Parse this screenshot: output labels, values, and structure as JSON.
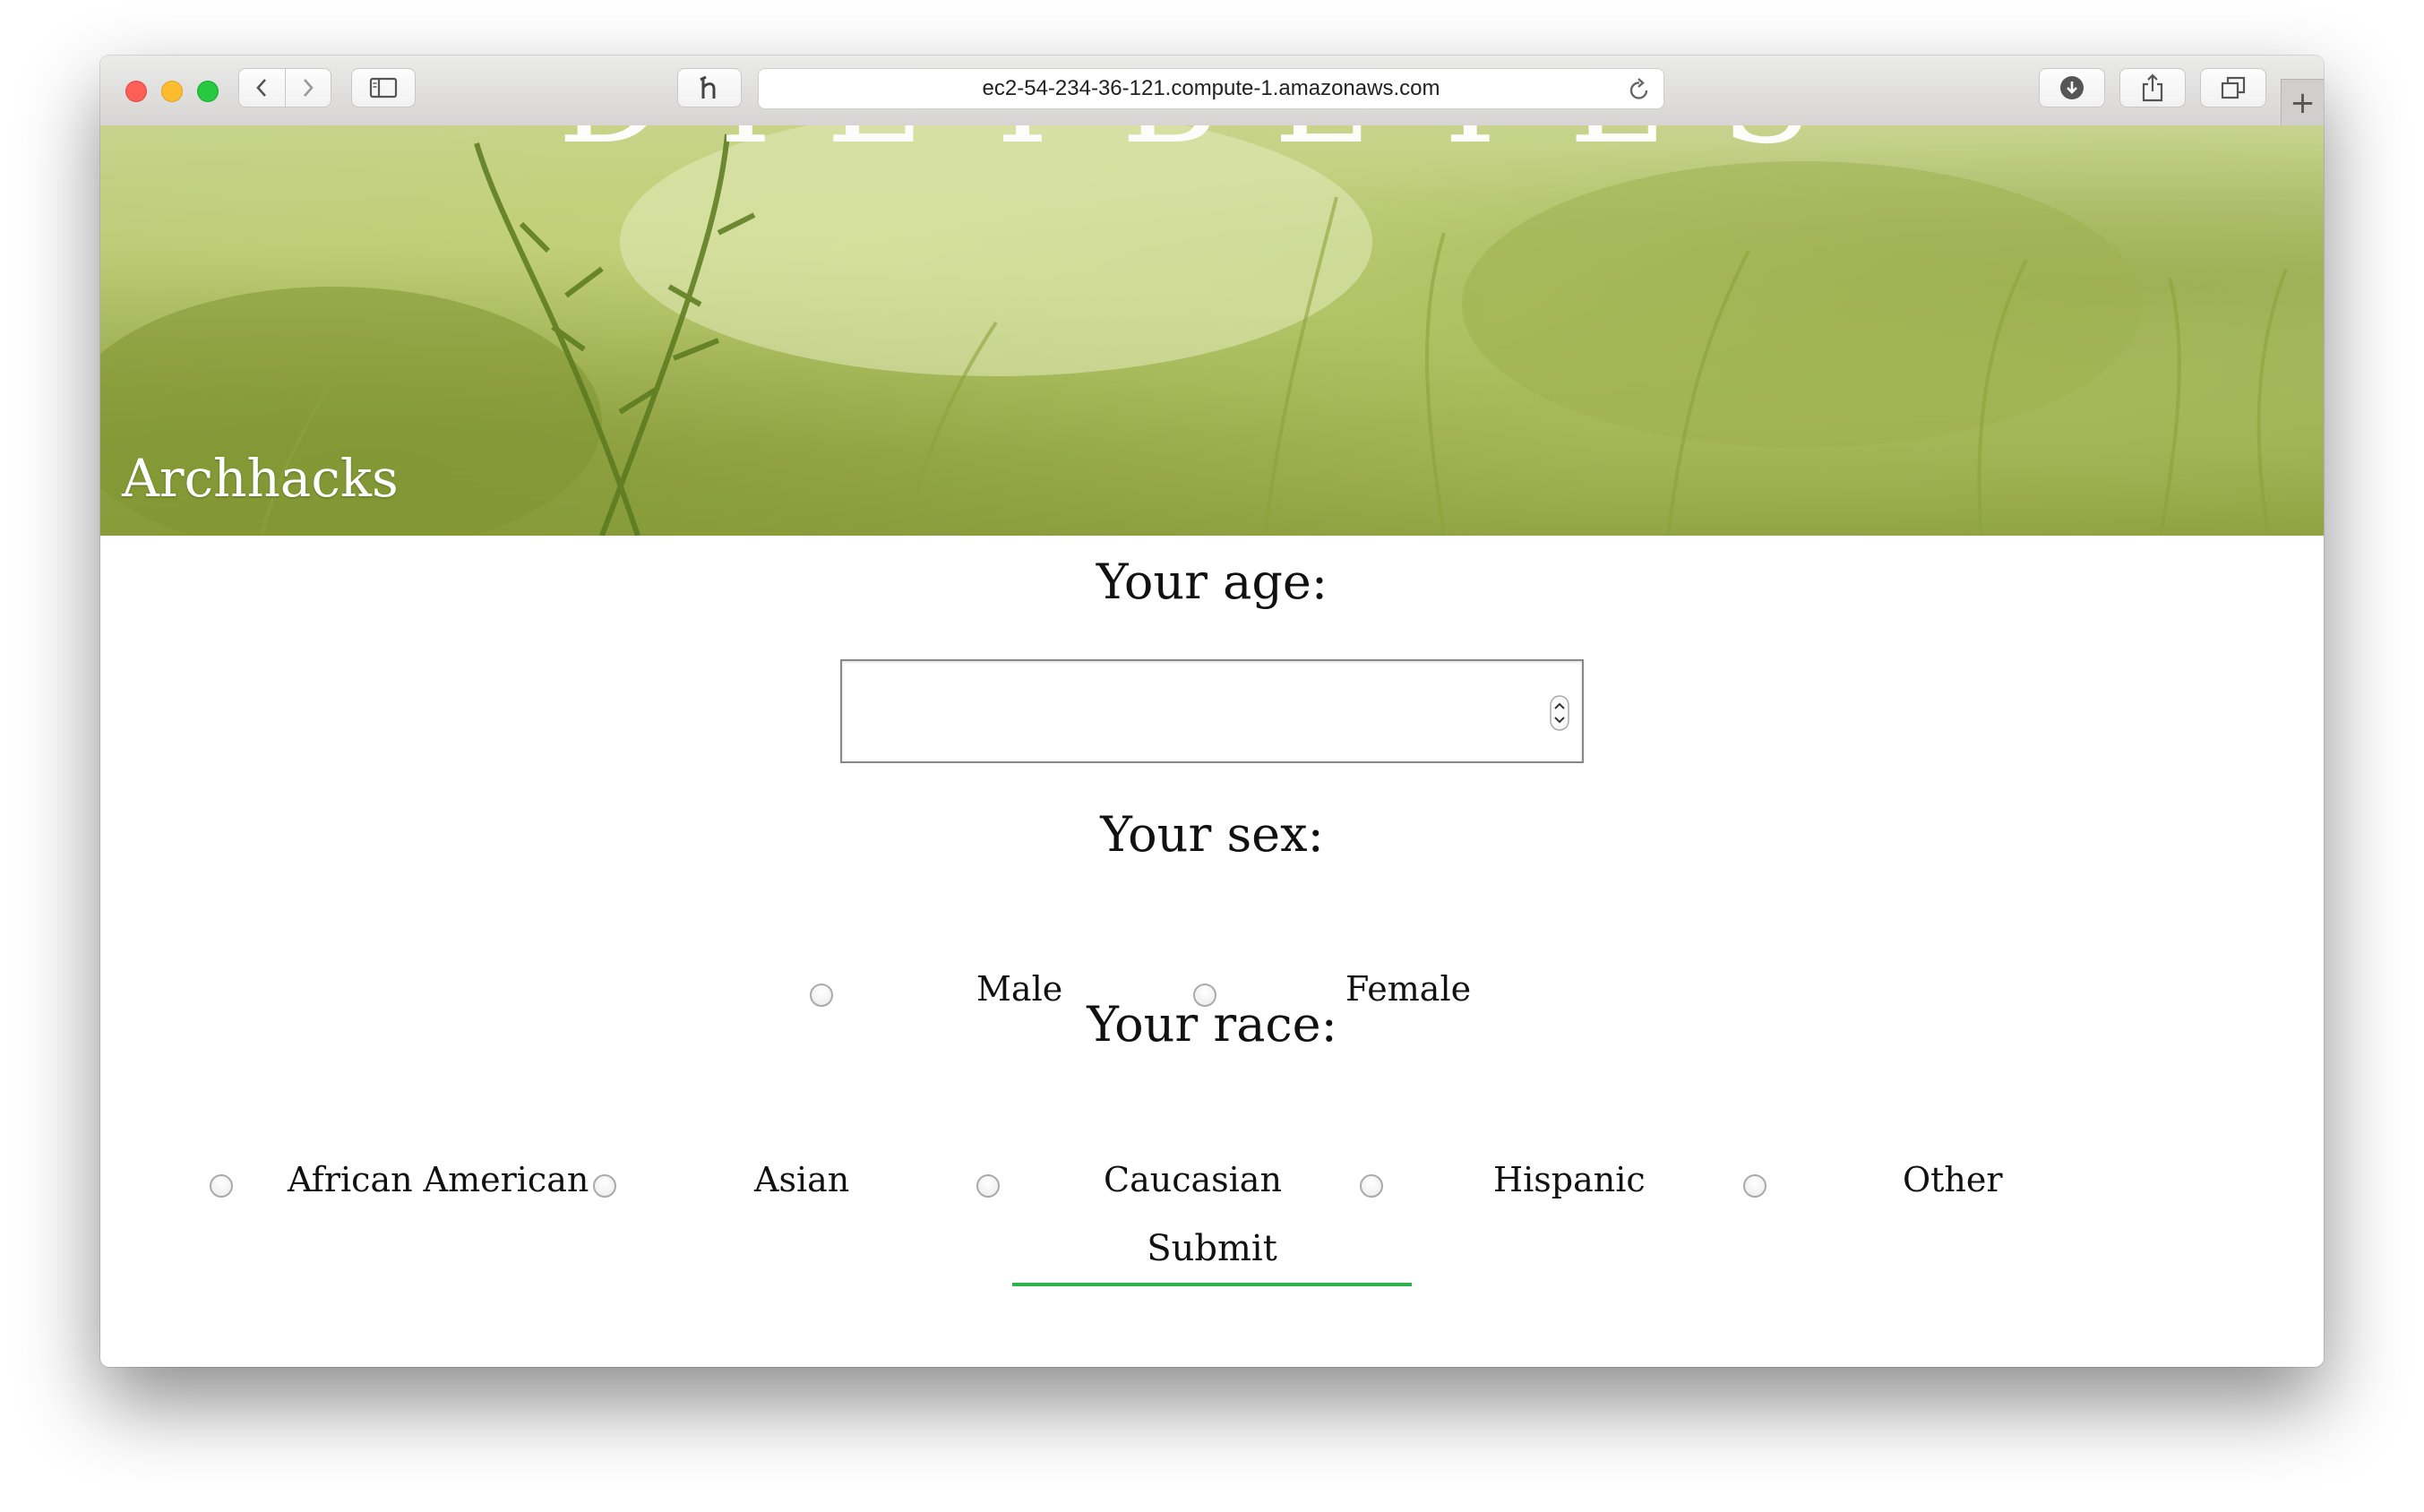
{
  "browser": {
    "url": "ec2-54-234-36-121.compute-1.amazonaws.com",
    "new_tab_label": "+"
  },
  "hero": {
    "title": "DIETBETES",
    "brand": "Archhacks"
  },
  "form": {
    "age_label": "Your age:",
    "age_value": "",
    "sex_label": "Your sex:",
    "sex_options": [
      "Male",
      "Female"
    ],
    "race_label": "Your race:",
    "race_options": [
      "African American",
      "Asian",
      "Caucasian",
      "Hispanic",
      "Other"
    ],
    "submit_label": "Submit"
  },
  "colors": {
    "submit_underline": "#2fb24a"
  }
}
